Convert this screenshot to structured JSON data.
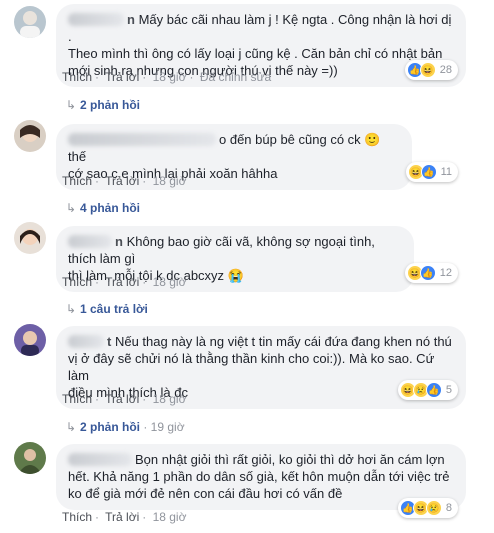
{
  "comments": [
    {
      "text_line1": "Mấy bác cãi nhau làm j ! Kệ ngta . Công nhận là hơi dị .",
      "text_line2": "Theo mình thì ông có lấy loại j cũng kệ . Căn bản chỉ có nhật bản",
      "text_line3": "mới sinh ra nhưng con người thú vị thế này =))",
      "author_suffix": "n",
      "like": "Thích",
      "reply": "Trả lời",
      "time": "18 giờ",
      "edited": "Đã chỉnh sửa",
      "reaction_count": "28",
      "reaction_icons": [
        "like-icon",
        "haha-icon"
      ],
      "replies_label": "2 phản hồi"
    },
    {
      "text_line1": "o đến búp bê cũng có ck 🙂 thế",
      "text_line2": "cớ sao c e mình lại phải xoăn hâhha",
      "like": "Thích",
      "reply": "Trả lời",
      "time": "18 giờ",
      "reaction_count": "11",
      "reaction_icons": [
        "haha-icon",
        "like-icon"
      ],
      "replies_label": "4 phản hồi"
    },
    {
      "text_line1": "Không bao giờ cãi vã, không sợ ngoại tình, thích làm gì",
      "text_line2": "thì làm, mỗi tội k dc abcxyz 😭",
      "author_suffix": "n",
      "like": "Thích",
      "reply": "Trả lời",
      "time": "18 giờ",
      "reaction_count": "12",
      "reaction_icons": [
        "haha-icon",
        "like-icon"
      ],
      "replies_label": "1 câu trả lời"
    },
    {
      "text_line1": "Nếu thag này là ng việt t tin mấy cái đứa đang khen nó thú",
      "text_line2": "vị ở đây sẽ chửi nó là thằng thần kinh cho coi:)). Mà ko sao. Cứ làm",
      "text_line3": "điều mình thích là đc",
      "author_suffix": "t",
      "like": "Thích",
      "reply": "Trả lời",
      "time": "18 giờ",
      "reaction_count": "5",
      "reaction_icons": [
        "haha-icon",
        "sad-icon",
        "like-icon"
      ],
      "replies_label": "2 phản hồi",
      "replies_time": "19 giờ"
    },
    {
      "text_line1": "Bọn nhật giỏi thì rất giỏi, ko giỏi thì dở hơi ăn cám lợn",
      "text_line2": "hết. Khả năng 1 phần do dân số già, kết hôn muộn dẫn tới việc trẻ",
      "text_line3": "ko để già mới đẻ nên con cái đầu hơi có vấn đề",
      "like": "Thích",
      "reply": "Trả lời",
      "time": "18 giờ",
      "reaction_count": "8",
      "reaction_icons": [
        "like-icon",
        "haha-icon",
        "sad-icon"
      ]
    }
  ],
  "colors": {
    "bubble": "#f2f3f5",
    "link": "#385898",
    "meta": "#90949c",
    "like_blue": "#3b82f6",
    "emoji_yellow": "#fcd34d"
  }
}
